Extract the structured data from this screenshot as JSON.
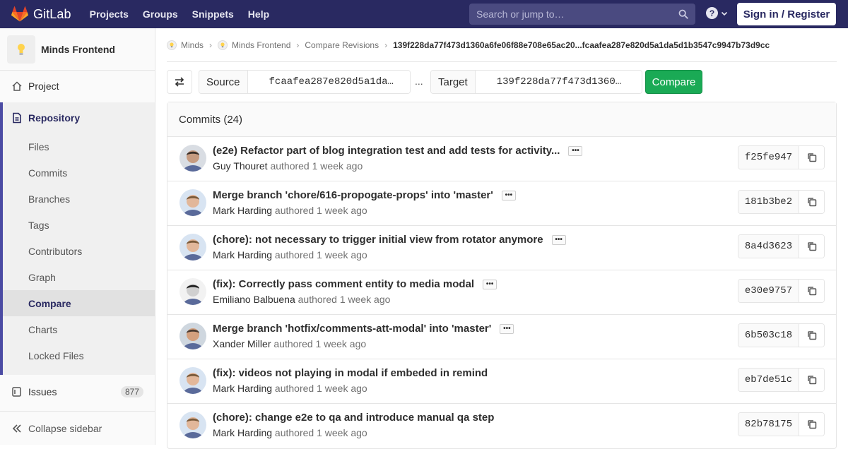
{
  "navbar": {
    "logo_text": "GitLab",
    "links": [
      "Projects",
      "Groups",
      "Snippets",
      "Help"
    ],
    "search_placeholder": "Search or jump to…",
    "signin_label": "Sign in / Register",
    "help_icon": "question-icon"
  },
  "sidebar": {
    "project_name": "Minds Frontend",
    "project_label": "Project",
    "repository_label": "Repository",
    "repo_items": [
      "Files",
      "Commits",
      "Branches",
      "Tags",
      "Contributors",
      "Graph",
      "Compare",
      "Charts",
      "Locked Files"
    ],
    "active_item": "Compare",
    "issues_label": "Issues",
    "issues_count": "877",
    "collapse_label": "Collapse sidebar"
  },
  "breadcrumbs": {
    "items": [
      "Minds",
      "Minds Frontend",
      "Compare Revisions"
    ],
    "current": "139f228da77f473d1360a6fe06f88e708e65ac20...fcaafea287e820d5a1da5d1b3547c9947b73d9cc"
  },
  "compare": {
    "source_label": "Source",
    "source_value": "fcaafea287e820d5a1da…",
    "separator": "...",
    "target_label": "Target",
    "target_value": "139f228da77f473d1360…",
    "compare_label": "Compare"
  },
  "commits": {
    "header": "Commits (24)",
    "authored_word": "authored",
    "rows": [
      {
        "title": "(e2e) Refactor part of blog integration test and add tests for activity...",
        "author": "Guy Thouret",
        "when": "1 week ago",
        "sha": "f25fe947"
      },
      {
        "title": "Merge branch 'chore/616-propogate-props' into 'master'",
        "author": "Mark Harding",
        "when": "1 week ago",
        "sha": "181b3be2"
      },
      {
        "title": "(chore): not necessary to trigger initial view from rotator anymore",
        "author": "Mark Harding",
        "when": "1 week ago",
        "sha": "8a4d3623"
      },
      {
        "title": "(fix): Correctly pass comment entity to media modal",
        "author": "Emiliano Balbuena",
        "when": "1 week ago",
        "sha": "e30e9757"
      },
      {
        "title": "Merge branch 'hotfix/comments-att-modal' into 'master'",
        "author": "Xander Miller",
        "when": "1 week ago",
        "sha": "6b503c18"
      },
      {
        "title": "(fix): videos not playing in modal if embeded in remind",
        "author": "Mark Harding",
        "when": "1 week ago",
        "sha": "eb7de51c"
      },
      {
        "title": "(chore): change e2e to qa and introduce manual qa step",
        "author": "Mark Harding",
        "when": "1 week ago",
        "sha": "82b78175"
      }
    ]
  },
  "colors": {
    "navbar_bg": "#292961",
    "compare_green": "#1aaa55",
    "sidebar_accent": "#4b4ba3"
  }
}
